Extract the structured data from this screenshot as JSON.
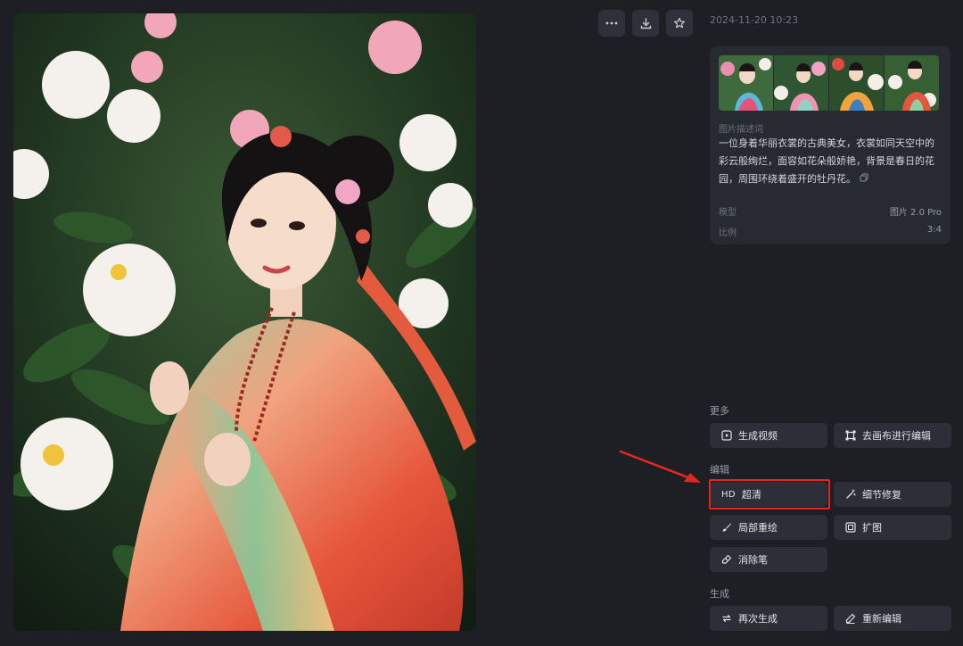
{
  "toolbar": {
    "more_icon": "ellipsis-icon",
    "download_icon": "download-icon",
    "favorite_icon": "star-icon"
  },
  "timestamp": "2024-11-20 10:23",
  "info": {
    "description_label": "图片描述词",
    "description_text": "一位身着华丽衣裳的古典美女，衣裳如同天空中的彩云般绚烂，面容如花朵般娇艳，背景是春日的花园，周围环绕着盛开的牡丹花。",
    "model_label": "模型",
    "model_value": "图片 2.0 Pro",
    "ratio_label": "比例",
    "ratio_value": "3:4"
  },
  "sections": {
    "more": "更多",
    "edit": "编辑",
    "generate": "生成"
  },
  "buttons": {
    "generate_video": "生成视频",
    "canvas_edit": "去画布进行编辑",
    "hd_prefix": "HD",
    "upscale": "超清",
    "detail_fix": "细节修复",
    "inpaint": "局部重绘",
    "expand": "扩图",
    "eraser": "消除笔",
    "regenerate": "再次生成",
    "reedit": "重新编辑"
  },
  "colors": {
    "background": "#1d1f25",
    "panel": "#272a31",
    "button": "#2c2f37",
    "highlight": "#e5281d"
  }
}
